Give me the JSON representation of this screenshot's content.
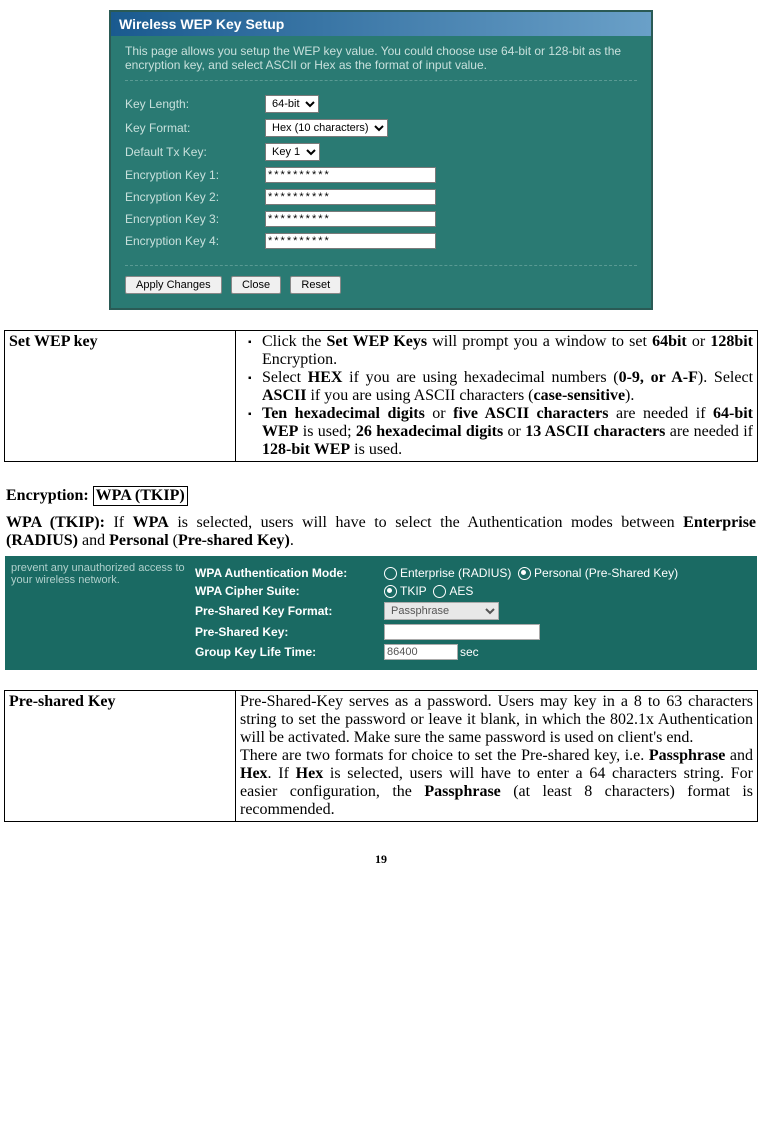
{
  "wep_setup": {
    "title": "Wireless WEP Key Setup",
    "description": "This page allows you setup the WEP key value. You could choose use 64-bit or 128-bit as the encryption key, and select ASCII or Hex as the format of input value.",
    "rows": {
      "key_length_label": "Key Length:",
      "key_length_value": "64-bit",
      "key_format_label": "Key Format:",
      "key_format_value": "Hex (10 characters)",
      "default_tx_label": "Default Tx Key:",
      "default_tx_value": "Key 1",
      "enc1_label": "Encryption Key 1:",
      "enc2_label": "Encryption Key 2:",
      "enc3_label": "Encryption Key 3:",
      "enc4_label": "Encryption Key 4:",
      "enc_value": "**********"
    },
    "buttons": {
      "apply": "Apply Changes",
      "close": "Close",
      "reset": "Reset"
    }
  },
  "table1": {
    "left": "Set WEP key",
    "items": [
      "Click the <b>Set WEP Keys</b> will prompt you a window to set <b>64bit</b> or <b>128bit</b> Encryption.",
      "Select <b>HEX</b> if you are using hexadecimal numbers (<b>0-9, or A-F</b>). Select <b>ASCII</b> if you are using ASCII characters (<b>case-sensitive</b>).",
      "<b>Ten hexadecimal digits</b> or <b>five ASCII characters</b>  are needed if <b>64-bit WEP</b> is used; <b>26 hexadecimal digits</b> or <b>13 ASCII characters</b> are needed if <b>128-bit WEP</b> is used."
    ]
  },
  "enc_heading": {
    "prefix": "Encryption: ",
    "box": "WPA (TKIP)"
  },
  "wpa_desc": "<b>WPA (TKIP):</b> If <b>WPA</b> is selected, users will have to select the Authentication modes between <b>Enterprise (RADIUS)</b> and <b>Personal</b> (<b>Pre-shared Key)</b>.",
  "wpa_panel": {
    "left_text": "prevent any unauthorized access to your wireless network.",
    "auth_mode_label": "WPA Authentication Mode:",
    "enterprise": "Enterprise (RADIUS)",
    "personal": "Personal (Pre-Shared Key)",
    "cipher_label": "WPA Cipher Suite:",
    "tkip": "TKIP",
    "aes": "AES",
    "psk_format_label": "Pre-Shared Key Format:",
    "psk_format_value": "Passphrase",
    "psk_label": "Pre-Shared Key:",
    "gklt_label": "Group Key Life Time:",
    "gklt_value": "86400",
    "gklt_unit": "sec"
  },
  "table2": {
    "left": "Pre-shared Key",
    "right": "Pre-Shared-Key serves as a password.  Users may key in a 8 to 63 characters string to set the password or leave it blank, in which the 802.1x Authentication will be activated. Make sure the same password is used on client's end.<br>There are two formats for choice to set the Pre-shared key, i.e. <b>Passphrase</b> and <b>Hex</b>. If <b>Hex</b> is selected, users will have to enter a 64 characters string. For easier configuration, the <b>Passphrase</b> (at least 8 characters) format is recommended."
  },
  "page_number": "19"
}
